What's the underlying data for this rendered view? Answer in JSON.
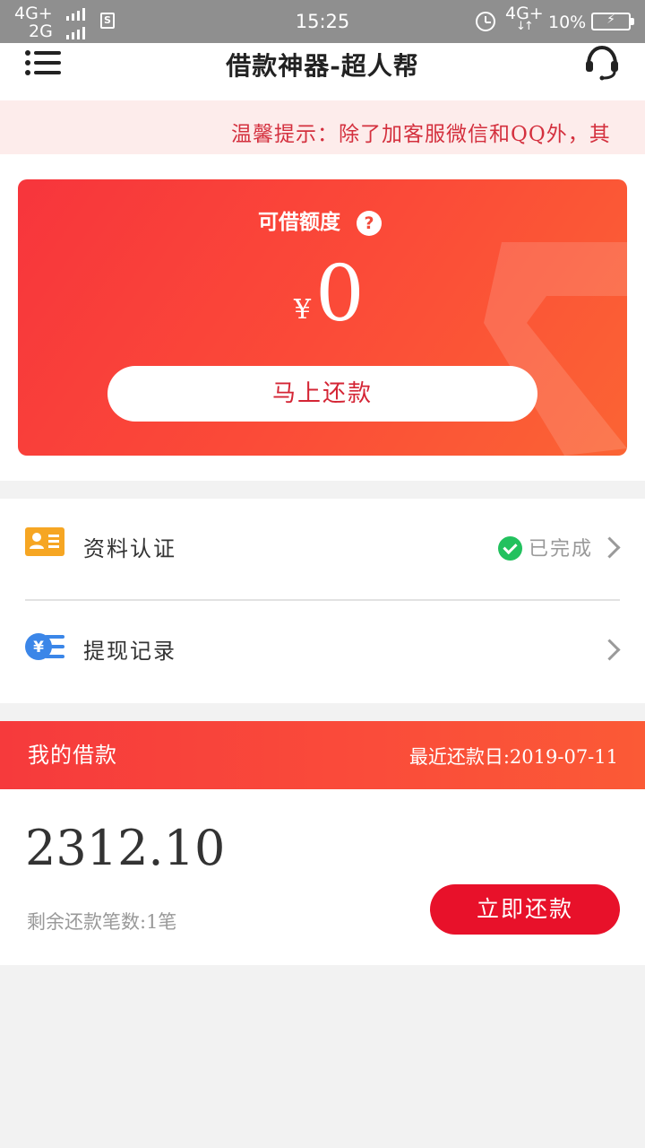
{
  "status_bar": {
    "network1": "4G+",
    "network2": "2G",
    "time": "15:25",
    "network3": "4G+",
    "battery": "10%"
  },
  "header": {
    "title": "借款神器-超人帮"
  },
  "notice": {
    "text": "温馨提示：除了加客服微信和QQ外，其"
  },
  "quota": {
    "label": "可借额度",
    "currency": "¥",
    "amount": "0",
    "button_label": "马上还款"
  },
  "menu": {
    "items": [
      {
        "label": "资料认证",
        "status": "已完成"
      },
      {
        "label": "提现记录",
        "status": ""
      }
    ]
  },
  "loan": {
    "title": "我的借款",
    "due_date": "最近还款日:2019-07-11",
    "amount": "2312.10",
    "remaining": "剩余还款笔数:1笔",
    "button_label": "立即还款"
  },
  "colors": {
    "primary_red": "#f63a3c",
    "button_red": "#e8112a",
    "notice_bg": "#fdeceb",
    "success_green": "#22c15e"
  },
  "icons": [
    "menu-icon",
    "customer-service-icon",
    "help-icon",
    "id-card-icon",
    "cash-record-icon",
    "check-icon",
    "chevron-right-icon"
  ]
}
